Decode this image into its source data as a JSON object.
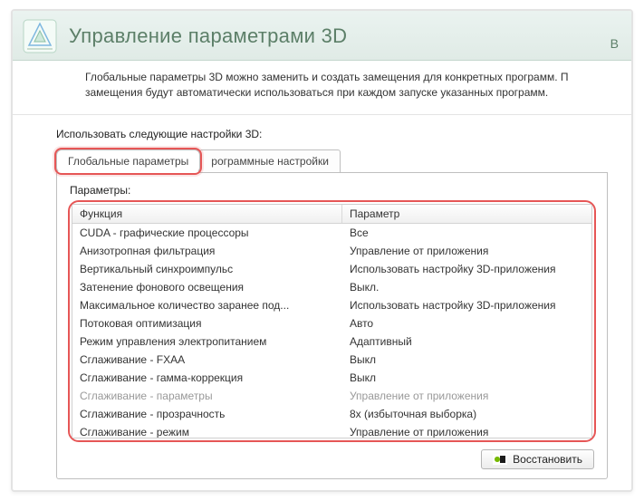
{
  "header": {
    "title": "Управление параметрами 3D",
    "trail": "В"
  },
  "description": "Глобальные параметры 3D можно заменить и создать замещения для конкретных программ. П замещения будут автоматически использоваться при каждом запуске указанных программ.",
  "section_label": "Использовать следующие настройки 3D:",
  "tabs": {
    "global": "Глобальные параметры",
    "program": "рограммные настройки"
  },
  "params_label": "Параметры:",
  "columns": {
    "func": "Функция",
    "param": "Параметр"
  },
  "rows": [
    {
      "func": "CUDA - графические процессоры",
      "param": "Все",
      "disabled": false
    },
    {
      "func": "Анизотропная фильтрация",
      "param": "Управление от приложения",
      "disabled": false
    },
    {
      "func": "Вертикальный синхроимпульс",
      "param": "Использовать настройку 3D-приложения",
      "disabled": false
    },
    {
      "func": "Затенение фонового освещения",
      "param": "Выкл.",
      "disabled": false
    },
    {
      "func": "Максимальное количество заранее под...",
      "param": "Использовать настройку 3D-приложения",
      "disabled": false
    },
    {
      "func": "Потоковая оптимизация",
      "param": "Авто",
      "disabled": false
    },
    {
      "func": "Режим управления электропитанием",
      "param": "Адаптивный",
      "disabled": false
    },
    {
      "func": "Сглаживание - FXAA",
      "param": "Выкл",
      "disabled": false
    },
    {
      "func": "Сглаживание - гамма-коррекция",
      "param": "Выкл",
      "disabled": false
    },
    {
      "func": "Сглаживание - параметры",
      "param": "Управление от приложения",
      "disabled": true
    },
    {
      "func": "Сглаживание - прозрачность",
      "param": "8x (избыточная выборка)",
      "disabled": false
    },
    {
      "func": "Сглаживание - режим",
      "param": "Управление от приложения",
      "disabled": false
    }
  ],
  "buttons": {
    "restore": "Восстановить"
  }
}
